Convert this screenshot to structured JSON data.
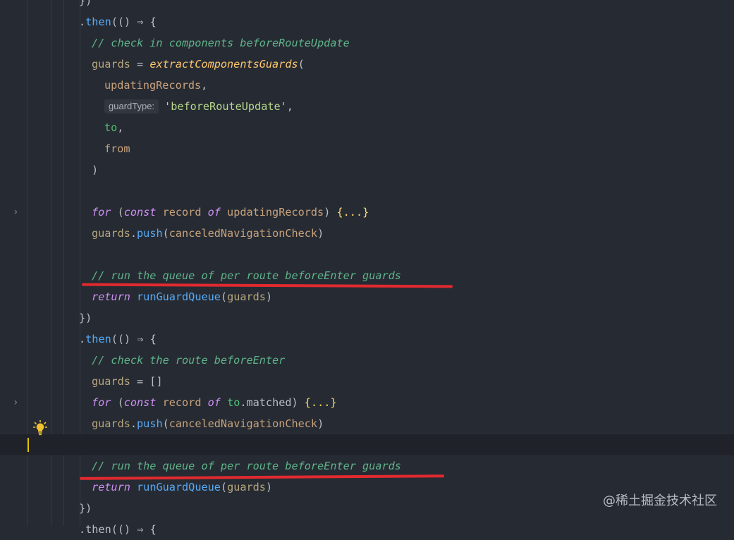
{
  "editor": {
    "lines": [
      {
        "tokens": [
          {
            "t": "})",
            "c": "tok-plain"
          }
        ]
      },
      {
        "tokens": [
          {
            "t": ".",
            "c": "tok-plain"
          },
          {
            "t": "then",
            "c": "tok-func"
          },
          {
            "t": "(() ⇒ {",
            "c": "tok-plain"
          }
        ]
      },
      {
        "tokens": [
          {
            "t": "// check in components beforeRouteUpdate",
            "c": "tok-comment"
          }
        ]
      },
      {
        "tokens": [
          {
            "t": "guards",
            "c": "tok-local"
          },
          {
            "t": " = ",
            "c": "tok-plain"
          },
          {
            "t": "extractComponentsGuards",
            "c": "tok-func-i"
          },
          {
            "t": "(",
            "c": "tok-plain"
          }
        ]
      },
      {
        "tokens": [
          {
            "t": "updatingRecords",
            "c": "tok-ident"
          },
          {
            "t": ",",
            "c": "tok-plain"
          }
        ]
      },
      {
        "tokens": [
          {
            "t": "guardType:",
            "c": "hint"
          },
          {
            "t": "'beforeRouteUpdate'",
            "c": "tok-string"
          },
          {
            "t": ",",
            "c": "tok-plain"
          }
        ]
      },
      {
        "tokens": [
          {
            "t": "to",
            "c": "tok-paramvar"
          },
          {
            "t": ",",
            "c": "tok-plain"
          }
        ]
      },
      {
        "tokens": [
          {
            "t": "from",
            "c": "tok-ident"
          }
        ]
      },
      {
        "tokens": [
          {
            "t": ")",
            "c": "tok-plain"
          }
        ]
      },
      {
        "tokens": []
      },
      {
        "tokens": [
          {
            "t": "for",
            "c": "tok-kw"
          },
          {
            "t": " (",
            "c": "tok-plain"
          },
          {
            "t": "const",
            "c": "tok-kw"
          },
          {
            "t": " record ",
            "c": "tok-ident"
          },
          {
            "t": "of",
            "c": "tok-kw"
          },
          {
            "t": " updatingRecords",
            "c": "tok-ident"
          },
          {
            "t": ") ",
            "c": "tok-plain"
          },
          {
            "t": "{...}",
            "c": "tok-brace"
          }
        ]
      },
      {
        "tokens": [
          {
            "t": "guards",
            "c": "tok-local"
          },
          {
            "t": ".",
            "c": "tok-plain"
          },
          {
            "t": "push",
            "c": "tok-func"
          },
          {
            "t": "(",
            "c": "tok-plain"
          },
          {
            "t": "canceledNavigationCheck",
            "c": "tok-ident"
          },
          {
            "t": ")",
            "c": "tok-plain"
          }
        ]
      },
      {
        "tokens": []
      },
      {
        "tokens": [
          {
            "t": "// run the queue of per route beforeEnter guards",
            "c": "tok-comment"
          }
        ]
      },
      {
        "tokens": [
          {
            "t": "return",
            "c": "tok-kw"
          },
          {
            "t": " ",
            "c": "tok-plain"
          },
          {
            "t": "runGuardQueue",
            "c": "tok-func"
          },
          {
            "t": "(",
            "c": "tok-plain"
          },
          {
            "t": "guards",
            "c": "tok-local"
          },
          {
            "t": ")",
            "c": "tok-plain"
          }
        ]
      },
      {
        "tokens": [
          {
            "t": "})",
            "c": "tok-plain"
          }
        ]
      },
      {
        "tokens": [
          {
            "t": ".",
            "c": "tok-plain"
          },
          {
            "t": "then",
            "c": "tok-func"
          },
          {
            "t": "(() ⇒ {",
            "c": "tok-plain"
          }
        ]
      },
      {
        "tokens": [
          {
            "t": "// check the route beforeEnter",
            "c": "tok-comment"
          }
        ]
      },
      {
        "tokens": [
          {
            "t": "guards",
            "c": "tok-local"
          },
          {
            "t": " = []",
            "c": "tok-plain"
          }
        ]
      },
      {
        "tokens": [
          {
            "t": "for",
            "c": "tok-kw"
          },
          {
            "t": " (",
            "c": "tok-plain"
          },
          {
            "t": "const",
            "c": "tok-kw"
          },
          {
            "t": " record ",
            "c": "tok-ident"
          },
          {
            "t": "of",
            "c": "tok-kw"
          },
          {
            "t": " ",
            "c": "tok-plain"
          },
          {
            "t": "to",
            "c": "tok-paramvar"
          },
          {
            "t": ".matched) ",
            "c": "tok-plain"
          },
          {
            "t": "{...}",
            "c": "tok-brace"
          }
        ]
      },
      {
        "tokens": [
          {
            "t": "guards",
            "c": "tok-local"
          },
          {
            "t": ".",
            "c": "tok-plain"
          },
          {
            "t": "push",
            "c": "tok-func"
          },
          {
            "t": "(",
            "c": "tok-plain"
          },
          {
            "t": "canceledNavigationCheck",
            "c": "tok-ident"
          },
          {
            "t": ")",
            "c": "tok-plain"
          }
        ]
      },
      {
        "tokens": []
      },
      {
        "tokens": [
          {
            "t": "// run the queue of per route beforeEnter guards",
            "c": "tok-comment"
          }
        ]
      },
      {
        "tokens": [
          {
            "t": "return",
            "c": "tok-kw"
          },
          {
            "t": " ",
            "c": "tok-plain"
          },
          {
            "t": "runGuardQueue",
            "c": "tok-func"
          },
          {
            "t": "(",
            "c": "tok-plain"
          },
          {
            "t": "guards",
            "c": "tok-local"
          },
          {
            "t": ")",
            "c": "tok-plain"
          }
        ]
      },
      {
        "tokens": [
          {
            "t": "})",
            "c": "tok-plain"
          }
        ]
      },
      {
        "tokens": [
          {
            "t": ".then(() ⇒ {",
            "c": "tok-plain"
          }
        ]
      }
    ]
  },
  "gutter": {
    "fold_icon": "chevron-right-icon",
    "intention_icon": "lightbulb-icon"
  },
  "annotations": {
    "color": "#e12a2f"
  },
  "watermark": "@稀土掘金技术社区"
}
